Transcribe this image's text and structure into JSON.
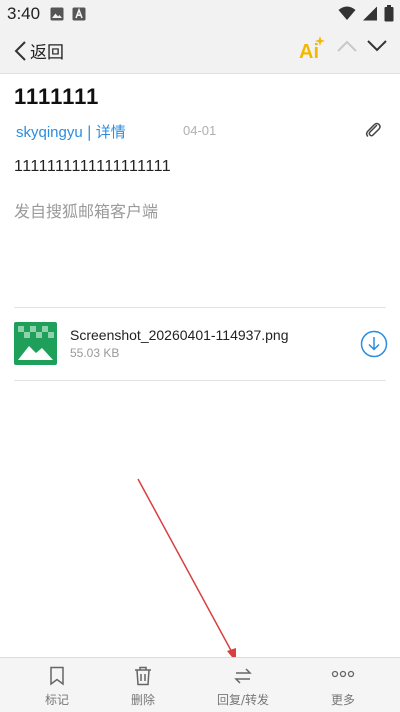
{
  "status_bar": {
    "time": "3:40"
  },
  "nav": {
    "back_label": "返回",
    "ai_label": "Ai"
  },
  "email": {
    "subject": "1111111",
    "sender": "skyqingyu",
    "separator": "|",
    "details_label": "详情",
    "date": "04-01",
    "body": "1111111111111111111",
    "signature": "发自搜狐邮箱客户端"
  },
  "attachment": {
    "file_name": "Screenshot_20260401-114937.png",
    "file_size": "55.03 KB"
  },
  "bottom_bar": {
    "mark": "标记",
    "delete": "删除",
    "reply_forward": "回复/转发",
    "more": "更多"
  },
  "colors": {
    "accent": "#2b8de0",
    "ai": "#f5b800",
    "thumb": "#1fa05a",
    "annotation_arrow": "#d84040"
  }
}
